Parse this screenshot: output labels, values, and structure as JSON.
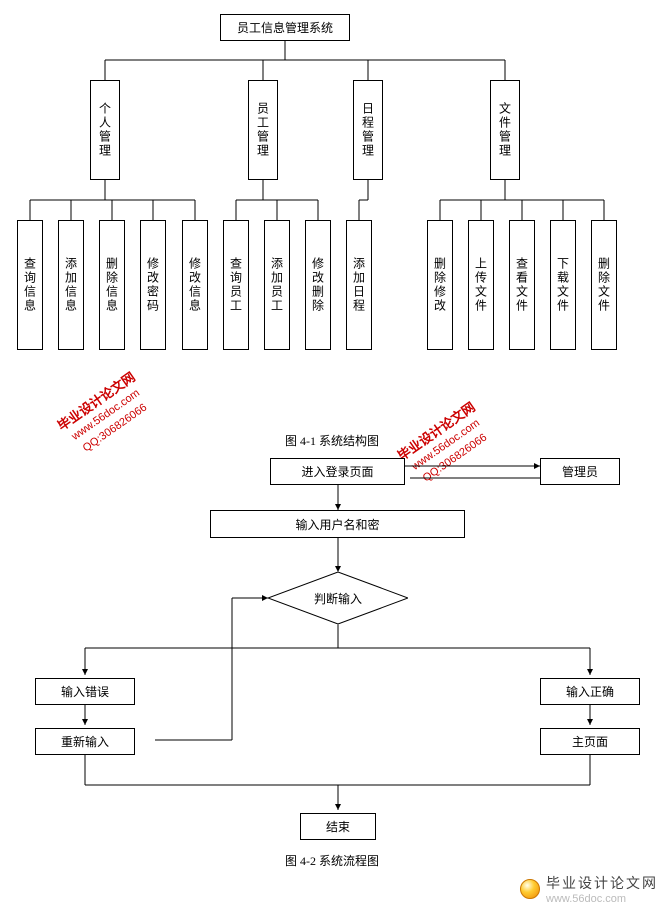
{
  "tree": {
    "root": "员工信息管理系统",
    "level1": [
      "个人管理",
      "员工管理",
      "日程管理",
      "文件管理"
    ],
    "leaves": [
      "查询信息",
      "添加信息",
      "删除信息",
      "修改密码",
      "修改信息",
      "查询员工",
      "添加员工",
      "修改删除",
      "添加日程",
      "删除修改",
      "上传文件",
      "查看文件",
      "下载文件",
      "删除文件"
    ]
  },
  "captions": {
    "fig1": "图 4-1 系统结构图",
    "fig2": "图 4-2 系统流程图"
  },
  "flow": {
    "enter": "进入登录页面",
    "admin": "管理员",
    "input_creds": "输入用户名和密",
    "decide": "判断输入",
    "wrong": "输入错误",
    "right": "输入正确",
    "reinput": "重新输入",
    "mainpage": "主页面",
    "end": "结束"
  },
  "watermark": {
    "cn": "毕业设计论文网",
    "url": "www.56doc.com",
    "qq": "QQ:306826066"
  },
  "footer": {
    "cn": "毕业设计论文网",
    "url": "www.56doc.com"
  }
}
